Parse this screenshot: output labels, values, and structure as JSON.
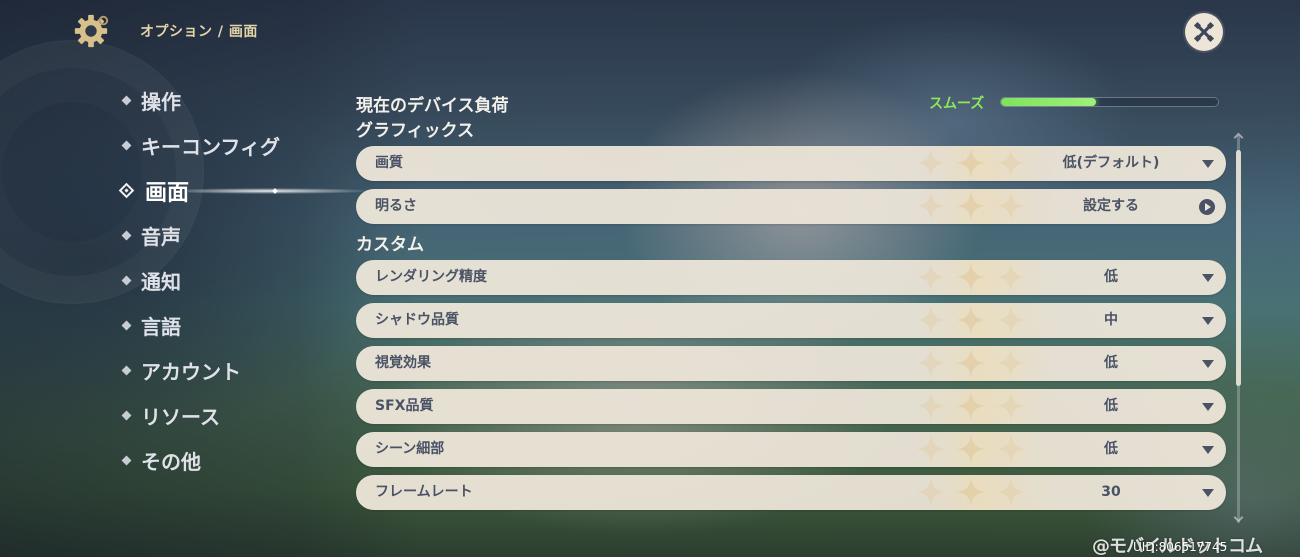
{
  "header": {
    "breadcrumb": "オプション / 画面"
  },
  "sidebar": {
    "items": [
      {
        "label": "操作",
        "active": false
      },
      {
        "label": "キーコンフィグ",
        "active": false
      },
      {
        "label": "画面",
        "active": true
      },
      {
        "label": "音声",
        "active": false
      },
      {
        "label": "通知",
        "active": false
      },
      {
        "label": "言語",
        "active": false
      },
      {
        "label": "アカウント",
        "active": false
      },
      {
        "label": "リソース",
        "active": false
      },
      {
        "label": "その他",
        "active": false
      }
    ]
  },
  "device_load": {
    "label": "現在のデバイス負荷",
    "status": "スムーズ",
    "level": 0.44,
    "status_color": "#8ee85a"
  },
  "sections": [
    {
      "title": "グラフィックス",
      "rows": [
        {
          "label": "画質",
          "value": "低(デフォルト)",
          "control": "dropdown"
        },
        {
          "label": "明るさ",
          "value": "設定する",
          "control": "button"
        }
      ]
    },
    {
      "title": "カスタム",
      "rows": [
        {
          "label": "レンダリング精度",
          "value": "低",
          "control": "dropdown"
        },
        {
          "label": "シャドウ品質",
          "value": "中",
          "control": "dropdown"
        },
        {
          "label": "視覚効果",
          "value": "低",
          "control": "dropdown"
        },
        {
          "label": "SFX品質",
          "value": "低",
          "control": "dropdown"
        },
        {
          "label": "シーン細部",
          "value": "低",
          "control": "dropdown"
        },
        {
          "label": "フレームレート",
          "value": "30",
          "control": "dropdown"
        }
      ]
    }
  ],
  "footer": {
    "uid": "UID:806517745",
    "watermark": "@モバイルドットコム"
  },
  "icons": {
    "settings": "gear-icon",
    "close": "close-icon",
    "dropdown": "caret-down-icon",
    "navigate": "arrow-right-circle-icon"
  },
  "colors": {
    "accent_gold": "#e5d4a8",
    "row_background": "#ece5d8",
    "row_text": "#4a5366",
    "load_bar": "#7fe35b"
  }
}
